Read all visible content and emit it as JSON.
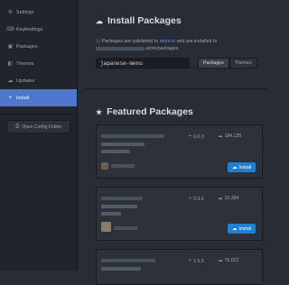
{
  "sidebar": {
    "items": [
      {
        "label": "Settings",
        "icon": "gear-icon",
        "glyph": "⚙"
      },
      {
        "label": "Keybindings",
        "icon": "keyboard-icon",
        "glyph": "⌨"
      },
      {
        "label": "Packages",
        "icon": "package-icon",
        "glyph": "▣"
      },
      {
        "label": "Themes",
        "icon": "paintcan-icon",
        "glyph": "◧"
      },
      {
        "label": "Updates",
        "icon": "cloud-download-icon",
        "glyph": "☁"
      },
      {
        "label": "Install",
        "icon": "plus-icon",
        "glyph": "+"
      }
    ],
    "active_index": 5,
    "config_button": {
      "label": "Open Config Folder",
      "glyph": "⎙"
    }
  },
  "install": {
    "title": "Install Packages",
    "title_glyph": "☁",
    "info_prefix": "Packages are published to",
    "info_link": "atom.io",
    "info_middle": "and are installed to",
    "info_suffix": ".atom/packages",
    "search_value": "japanese-menu",
    "toggle_packages": "Packages",
    "toggle_themes": "Themes"
  },
  "featured": {
    "title": "Featured Packages",
    "title_glyph": "★",
    "packages": [
      {
        "version": "0.6.0",
        "downloads": "184,135",
        "install_label": "Install"
      },
      {
        "version": "0.3.0",
        "downloads": "16,384",
        "install_label": "Install"
      },
      {
        "version": "1.5.3",
        "downloads": "76,022"
      }
    ]
  },
  "colors": {
    "accent": "#4d78cc",
    "install_button": "#1f7fd4",
    "link": "#6494ed"
  }
}
